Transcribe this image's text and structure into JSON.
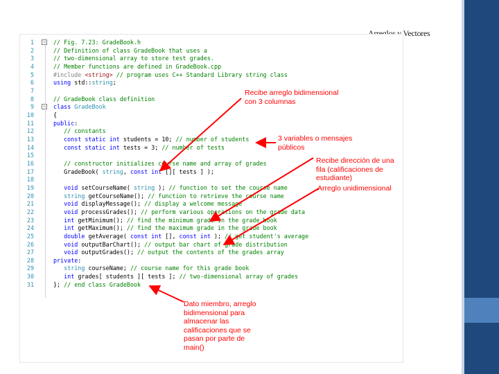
{
  "slide": {
    "title": "Arreglos y Vectores"
  },
  "code_lines": [
    {
      "n": "1",
      "fold": true,
      "parts": [
        {
          "t": "// Fig. 7.23: GradeBook.h",
          "c": "comment"
        }
      ]
    },
    {
      "n": "2",
      "parts": [
        {
          "t": "// Definition of class GradeBook that uses a",
          "c": "comment"
        }
      ]
    },
    {
      "n": "3",
      "parts": [
        {
          "t": "// two-dimensional array to store test grades.",
          "c": "comment"
        }
      ]
    },
    {
      "n": "4",
      "parts": [
        {
          "t": "// Member functions are defined in GradeBook.cpp",
          "c": "comment"
        }
      ]
    },
    {
      "n": "5",
      "parts": [
        {
          "t": "#include ",
          "c": "pp"
        },
        {
          "t": "<string>",
          "c": "str"
        },
        {
          "t": " // program uses C++ Standard Library string class",
          "c": "comment"
        }
      ]
    },
    {
      "n": "6",
      "parts": [
        {
          "t": "using ",
          "c": "kw"
        },
        {
          "t": "std::",
          "c": ""
        },
        {
          "t": "string",
          "c": "type"
        },
        {
          "t": ";",
          "c": ""
        }
      ]
    },
    {
      "n": "7",
      "parts": []
    },
    {
      "n": "8",
      "parts": [
        {
          "t": "// GradeBook class definition",
          "c": "comment"
        }
      ]
    },
    {
      "n": "9",
      "fold": true,
      "parts": [
        {
          "t": "class ",
          "c": "kw"
        },
        {
          "t": "GradeBook",
          "c": "type"
        }
      ]
    },
    {
      "n": "10",
      "parts": [
        {
          "t": "{",
          "c": ""
        }
      ]
    },
    {
      "n": "11",
      "parts": [
        {
          "t": "public",
          "c": "kw"
        },
        {
          "t": ":",
          "c": ""
        }
      ]
    },
    {
      "n": "12",
      "parts": [
        {
          "t": "   // constants",
          "c": "comment"
        }
      ]
    },
    {
      "n": "13",
      "parts": [
        {
          "t": "   ",
          "c": ""
        },
        {
          "t": "const static int ",
          "c": "kw"
        },
        {
          "t": "students = 10; ",
          "c": ""
        },
        {
          "t": "// number of students",
          "c": "comment"
        }
      ]
    },
    {
      "n": "14",
      "parts": [
        {
          "t": "   ",
          "c": ""
        },
        {
          "t": "const static int ",
          "c": "kw"
        },
        {
          "t": "tests = 3; ",
          "c": ""
        },
        {
          "t": "// number of tests",
          "c": "comment"
        }
      ]
    },
    {
      "n": "15",
      "parts": []
    },
    {
      "n": "16",
      "parts": [
        {
          "t": "   // constructor initializes course name and array of grades",
          "c": "comment"
        }
      ]
    },
    {
      "n": "17",
      "parts": [
        {
          "t": "   GradeBook( ",
          "c": ""
        },
        {
          "t": "string",
          "c": "type"
        },
        {
          "t": ", ",
          "c": ""
        },
        {
          "t": "const int ",
          "c": "kw"
        },
        {
          "t": "[][ tests ] );",
          "c": ""
        }
      ]
    },
    {
      "n": "18",
      "parts": []
    },
    {
      "n": "19",
      "parts": [
        {
          "t": "   ",
          "c": ""
        },
        {
          "t": "void ",
          "c": "kw"
        },
        {
          "t": "setCourseName( ",
          "c": ""
        },
        {
          "t": "string",
          "c": "type"
        },
        {
          "t": " ); ",
          "c": ""
        },
        {
          "t": "// function to set the course name",
          "c": "comment"
        }
      ]
    },
    {
      "n": "20",
      "parts": [
        {
          "t": "   ",
          "c": ""
        },
        {
          "t": "string ",
          "c": "type"
        },
        {
          "t": "getCourseName(); ",
          "c": ""
        },
        {
          "t": "// function to retrieve the course name",
          "c": "comment"
        }
      ]
    },
    {
      "n": "21",
      "parts": [
        {
          "t": "   ",
          "c": ""
        },
        {
          "t": "void ",
          "c": "kw"
        },
        {
          "t": "displayMessage(); ",
          "c": ""
        },
        {
          "t": "// display a welcome message",
          "c": "comment"
        }
      ]
    },
    {
      "n": "22",
      "parts": [
        {
          "t": "   ",
          "c": ""
        },
        {
          "t": "void ",
          "c": "kw"
        },
        {
          "t": "processGrades(); ",
          "c": ""
        },
        {
          "t": "// perform various operations on the grade data",
          "c": "comment"
        }
      ]
    },
    {
      "n": "23",
      "parts": [
        {
          "t": "   ",
          "c": ""
        },
        {
          "t": "int ",
          "c": "kw"
        },
        {
          "t": "getMinimum(); ",
          "c": ""
        },
        {
          "t": "// find the minimum grade in the grade book",
          "c": "comment"
        }
      ]
    },
    {
      "n": "24",
      "parts": [
        {
          "t": "   ",
          "c": ""
        },
        {
          "t": "int ",
          "c": "kw"
        },
        {
          "t": "getMaximum(); ",
          "c": ""
        },
        {
          "t": "// find the maximum grade in the grade book",
          "c": "comment"
        }
      ]
    },
    {
      "n": "25",
      "parts": [
        {
          "t": "   ",
          "c": ""
        },
        {
          "t": "double ",
          "c": "kw"
        },
        {
          "t": "getAverage( ",
          "c": ""
        },
        {
          "t": "const int ",
          "c": "kw"
        },
        {
          "t": "[], ",
          "c": ""
        },
        {
          "t": "const int ",
          "c": "kw"
        },
        {
          "t": "); ",
          "c": ""
        },
        {
          "t": "// get student's average",
          "c": "comment"
        }
      ]
    },
    {
      "n": "26",
      "parts": [
        {
          "t": "   ",
          "c": ""
        },
        {
          "t": "void ",
          "c": "kw"
        },
        {
          "t": "outputBarChart(); ",
          "c": ""
        },
        {
          "t": "// output bar chart of grade distribution",
          "c": "comment"
        }
      ]
    },
    {
      "n": "27",
      "parts": [
        {
          "t": "   ",
          "c": ""
        },
        {
          "t": "void ",
          "c": "kw"
        },
        {
          "t": "outputGrades(); ",
          "c": ""
        },
        {
          "t": "// output the contents of the grades array",
          "c": "comment"
        }
      ]
    },
    {
      "n": "28",
      "parts": [
        {
          "t": "private",
          "c": "kw"
        },
        {
          "t": ":",
          "c": ""
        }
      ]
    },
    {
      "n": "29",
      "parts": [
        {
          "t": "   ",
          "c": ""
        },
        {
          "t": "string ",
          "c": "type"
        },
        {
          "t": "courseName; ",
          "c": ""
        },
        {
          "t": "// course name for this grade book",
          "c": "comment"
        }
      ]
    },
    {
      "n": "30",
      "parts": [
        {
          "t": "   ",
          "c": ""
        },
        {
          "t": "int ",
          "c": "kw"
        },
        {
          "t": "grades[ students ][ tests ]; ",
          "c": ""
        },
        {
          "t": "// two-dimensional array of grades",
          "c": "comment"
        }
      ]
    },
    {
      "n": "31",
      "parts": [
        {
          "t": "}; ",
          "c": ""
        },
        {
          "t": "// end class GradeBook",
          "c": "comment"
        }
      ]
    }
  ],
  "annotations": {
    "bidim_param": [
      "Recibe arreglo bidimensional",
      "con 3 columnas"
    ],
    "public_vars": [
      "3 variables o mensajes",
      "públicos"
    ],
    "row_address": [
      "Recibe dirección de una",
      "fila (calificaciones de",
      "estudiante)"
    ],
    "unidim": [
      "Arreglo unidimensional"
    ],
    "data_member": [
      "Dato miembro, arreglo",
      "bidimensional para",
      "almacenar las",
      "calificaciones que se",
      "pasan por parte de",
      "main()"
    ]
  },
  "colors": {
    "annotation": "#ff0000",
    "comment": "#008000",
    "keyword": "#0000ff",
    "type": "#2b91af",
    "accent_dark": "#1f497d",
    "accent_light": "#4f81bd"
  }
}
